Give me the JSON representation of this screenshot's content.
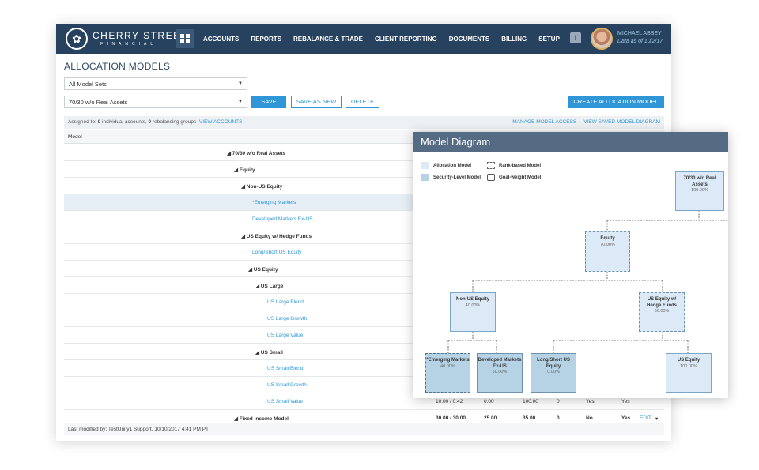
{
  "nav": {
    "logo_name": "CHERRY STREET",
    "logo_sub": "FINANCIAL",
    "items": [
      "ACCOUNTS",
      "REPORTS",
      "REBALANCE & TRADE",
      "CLIENT REPORTING",
      "DOCUMENTS",
      "BILLING",
      "SETUP"
    ],
    "alert_glyph": "!",
    "user_name": "MICHAEL ABBEY",
    "user_date": "Data as of 10/2/17"
  },
  "page": {
    "title": "ALLOCATION MODELS",
    "model_set": "All Model Sets",
    "model": "70/30 w/o Real Assets",
    "save": "SAVE",
    "save_as_new": "SAVE AS NEW",
    "delete": "DELETE",
    "create": "CREATE ALLOCATION MODEL"
  },
  "assign": {
    "prefix": "Assigned to: ",
    "accounts_count": "0",
    "mid": " individual accounts, ",
    "groups_count": "0",
    "suffix": " rebalancing groups",
    "view_accounts": "VIEW ACCOUNTS",
    "manage": "MANAGE MODEL ACCESS",
    "sep": "|",
    "view_diagram": "VIEW SAVED MODEL DIAGRAM"
  },
  "table": {
    "col_model": "Model",
    "rows": [
      {
        "label": "◢ 70/30 w/o Real Assets",
        "indent": 206,
        "style": "bold"
      },
      {
        "label": "◢ Equity",
        "indent": 215,
        "style": "bold"
      },
      {
        "label": "◢ Non-US Equity",
        "indent": 224,
        "style": "bold"
      },
      {
        "label": "*Emerging Markets",
        "indent": 238,
        "style": "link",
        "selected": true
      },
      {
        "label": "Developed Markets Ex-US",
        "indent": 238,
        "style": "link"
      },
      {
        "label": "◢ US Equity w/ Hedge Funds",
        "indent": 224,
        "style": "bold"
      },
      {
        "label": "Long/Short US Equity",
        "indent": 238,
        "style": "link"
      },
      {
        "label": "◢ US Equity",
        "indent": 233,
        "style": "bold"
      },
      {
        "label": "◢ US Large",
        "indent": 242,
        "style": "bold"
      },
      {
        "label": "US Large Blend",
        "indent": 257,
        "style": "link"
      },
      {
        "label": "US Large Growth",
        "indent": 257,
        "style": "link"
      },
      {
        "label": "US Large Value",
        "indent": 257,
        "style": "link"
      },
      {
        "label": "◢ US Small",
        "indent": 242,
        "style": "bold"
      },
      {
        "label": "US Small Blend",
        "indent": 257,
        "style": "link"
      },
      {
        "label": "US Small Growth",
        "indent": 257,
        "style": "link"
      },
      {
        "label": "US Small Value",
        "indent": 257,
        "style": "link",
        "values": [
          "10.00 / 0.42",
          "0.00",
          "100.00",
          "0",
          "Yes",
          "Yes"
        ]
      },
      {
        "label": "◢ Fixed Income Model",
        "indent": 215,
        "style": "bold",
        "values": [
          "30.00 / 30.00",
          "25.00",
          "35.00",
          "0",
          "No",
          "Yes"
        ],
        "edit": "EDIT",
        "caret": "▾"
      }
    ]
  },
  "footer": "Last modified by: TestUnify1 Support, 10/10/2017 4:41 PM PT",
  "diagram": {
    "title": "Model Diagram",
    "legend": [
      "Allocation Model",
      "Rank-based Model",
      "Security-Level Model",
      "Goal-weight Model"
    ],
    "nodes": [
      {
        "name": "70/30 w/o Real Assets",
        "pct": "100.00%"
      },
      {
        "name": "Equity",
        "pct": "70.00%"
      },
      {
        "name": "Non-US Equity",
        "pct": "40.00%"
      },
      {
        "name": "US Equity w/ Hedge Funds",
        "pct": "60.00%"
      },
      {
        "name": "*Emerging Markets",
        "pct": "40.00%"
      },
      {
        "name": "Developed Markets Ex-US",
        "pct": "60.00%"
      },
      {
        "name": "Long/Short US Equity",
        "pct": "0.00%"
      },
      {
        "name": "US Equity",
        "pct": "100.00%"
      }
    ]
  }
}
